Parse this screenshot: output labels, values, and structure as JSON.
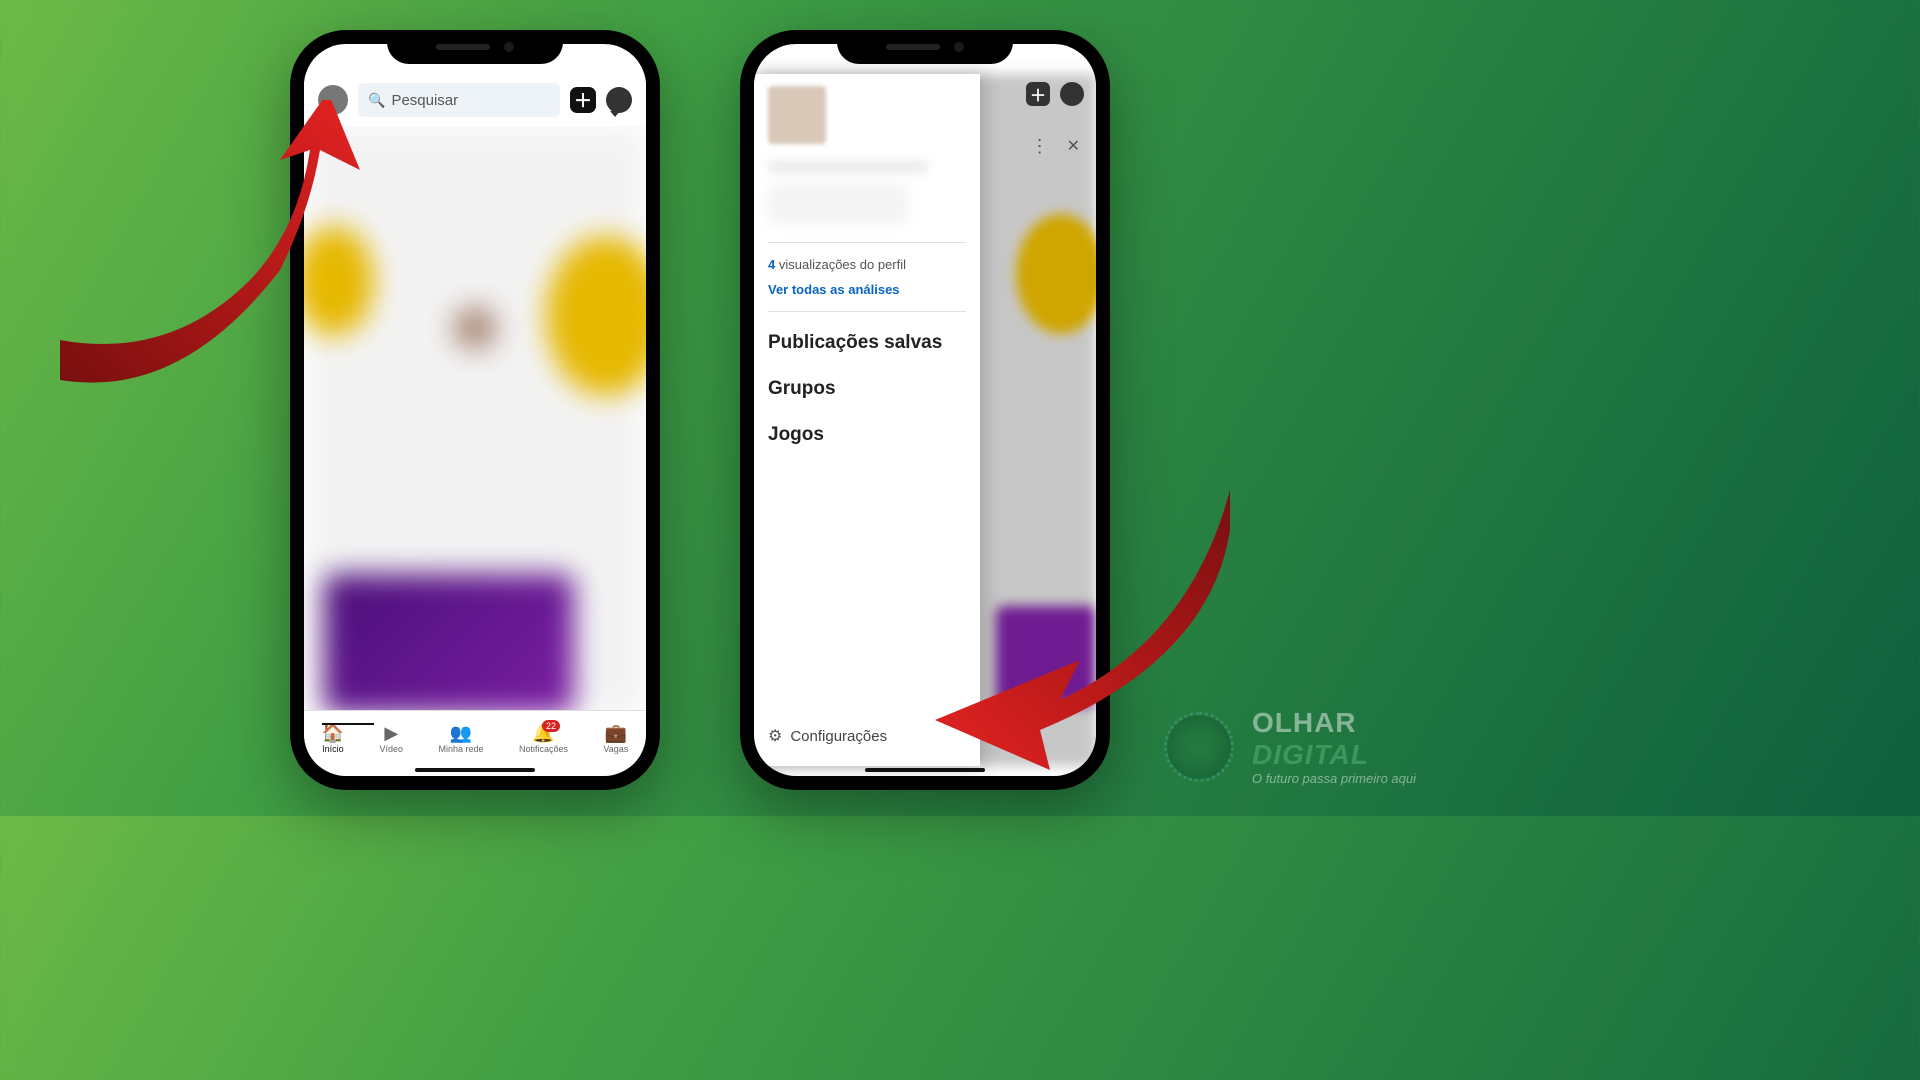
{
  "leftPhone": {
    "search": {
      "placeholder": "Pesquisar"
    },
    "nav": {
      "inicio": "Início",
      "video": "Vídeo",
      "rede": "Minha rede",
      "notif": "Notificações",
      "notifCount": "22",
      "vagas": "Vagas"
    }
  },
  "rightPhone": {
    "drawer": {
      "viewsCount": "4",
      "viewsLabel": " visualizações do perfil",
      "allAnalytics": "Ver todas as análises",
      "saved": "Publicações salvas",
      "grupos": "Grupos",
      "jogos": "Jogos",
      "config": "Configurações"
    }
  },
  "watermark": {
    "brand1": "OLHAR",
    "brand2": "DIGITAL",
    "tag": "O futuro passa primeiro aqui"
  }
}
